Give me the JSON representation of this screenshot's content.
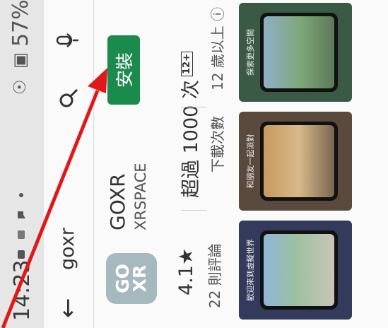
{
  "status_bar": {
    "time": "14:23",
    "battery": "57%",
    "signal_icons": "☉ ▣"
  },
  "search": {
    "back_icon": "arrow-left-icon",
    "query": "goxr"
  },
  "app": {
    "logo_top": "GO",
    "logo_bottom": "XR",
    "name": "GOXR",
    "developer": "XRSPACE",
    "install_label": "安裝",
    "install_color": "#1b8a4d"
  },
  "stats": {
    "rating": "4.1★",
    "reviews": "22 則評論",
    "downloads": "超過 1000 次",
    "downloads_label": "下載次數",
    "age_badge": "12+",
    "age_label": "12 歲以上 ⓘ"
  },
  "screenshots": [
    {
      "caption": "歡迎來到虛擬世界",
      "bg": "#343a5c"
    },
    {
      "caption": "和朋友一起派對",
      "bg": "#5a4a3e"
    },
    {
      "caption": "探索更多空間",
      "bg": "#3b5a45"
    }
  ]
}
